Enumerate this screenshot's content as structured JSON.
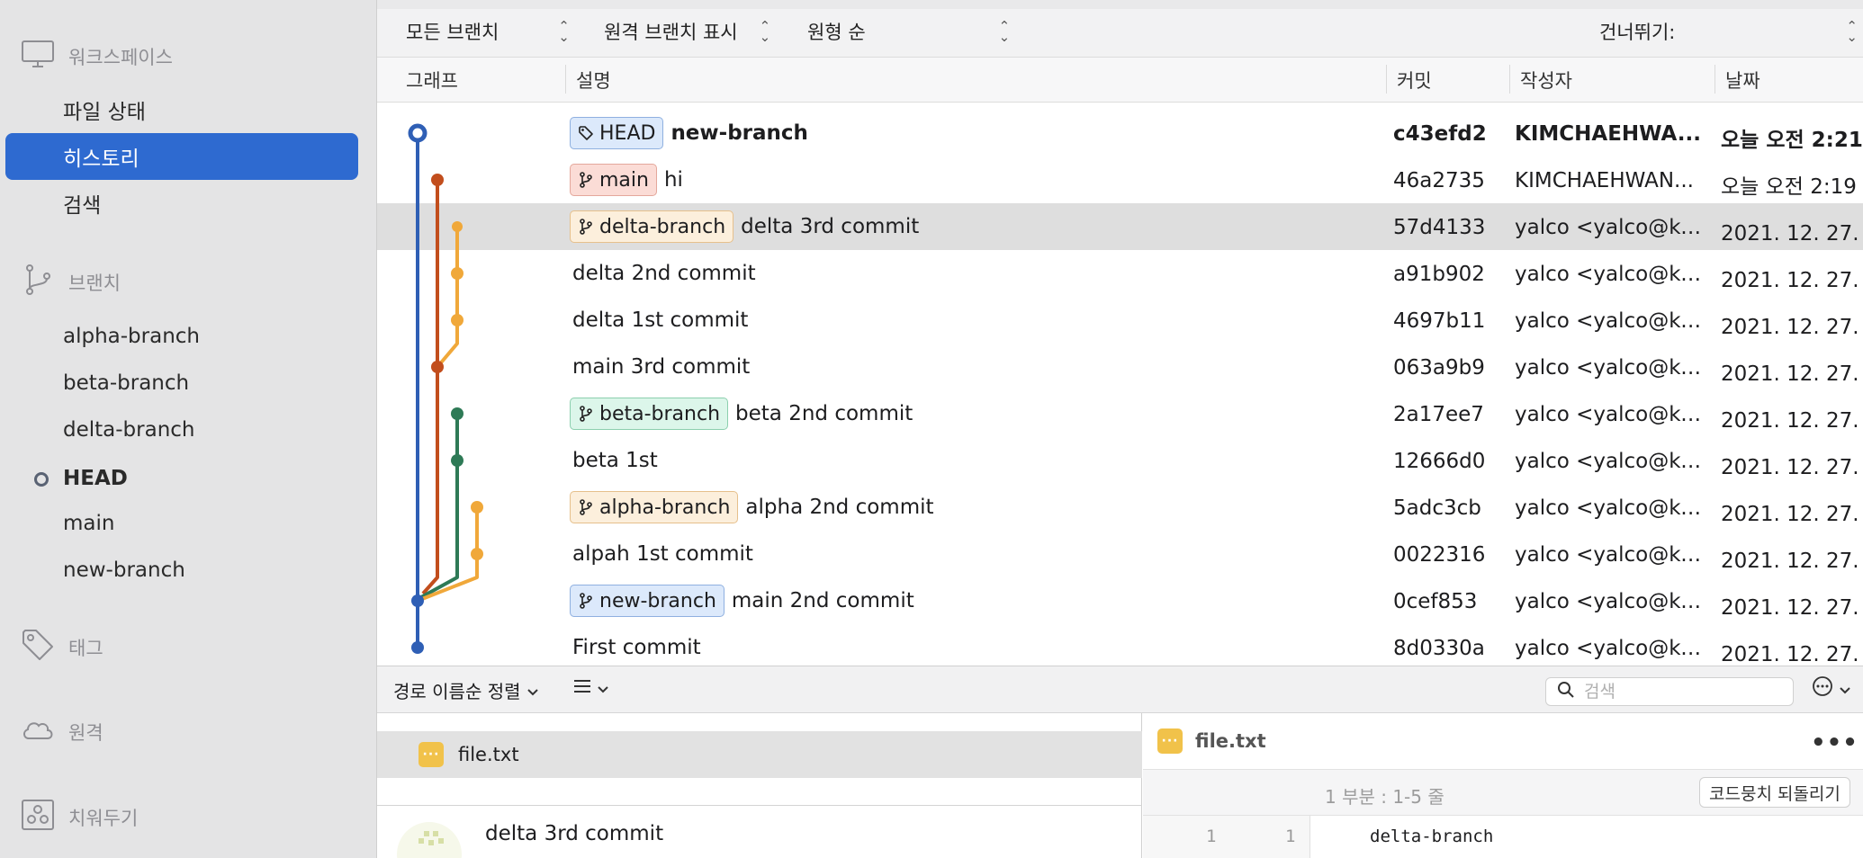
{
  "sidebar": {
    "workspace_label": "워크스페이스",
    "workspace_items": [
      {
        "label": "파일 상태",
        "active": false
      },
      {
        "label": "히스토리",
        "active": true
      },
      {
        "label": "검색",
        "active": false
      }
    ],
    "branches_label": "브랜치",
    "branches": [
      "alpha-branch",
      "beta-branch",
      "delta-branch",
      "HEAD",
      "main",
      "new-branch"
    ],
    "tags_label": "태그",
    "remotes_label": "원격",
    "stashes_label": "치워두기"
  },
  "filters": {
    "branch_filter": "모든 브랜치",
    "remote_filter": "원격 브랜치 표시",
    "order_filter": "원형 순",
    "jump_label": "건너뛰기:"
  },
  "columns": {
    "graph": "그래프",
    "description": "설명",
    "commit": "커밋",
    "author": "작성자",
    "date": "날짜"
  },
  "commits": [
    {
      "tag": "HEAD",
      "tag_kind": "head",
      "message": "new-branch",
      "hash": "c43efd2",
      "author": "KIMCHAEHWA...",
      "date": "오늘 오전 2:21",
      "bold": true,
      "selected": false
    },
    {
      "tag": "main",
      "tag_kind": "main",
      "message": "hi",
      "hash": "46a2735",
      "author": "KIMCHAEHWAN...",
      "date": "오늘 오전 2:19",
      "bold": false,
      "selected": false
    },
    {
      "tag": "delta-branch",
      "tag_kind": "delta",
      "message": "delta 3rd commit",
      "hash": "57d4133",
      "author": "yalco <yalco@ka...",
      "date": "2021. 12. 27. 오",
      "bold": false,
      "selected": true
    },
    {
      "tag": "",
      "tag_kind": "",
      "message": "delta 2nd commit",
      "hash": "a91b902",
      "author": "yalco <yalco@ka...",
      "date": "2021. 12. 27. 오",
      "bold": false,
      "selected": false
    },
    {
      "tag": "",
      "tag_kind": "",
      "message": "delta 1st commit",
      "hash": "4697b11",
      "author": "yalco <yalco@ka...",
      "date": "2021. 12. 27. 오",
      "bold": false,
      "selected": false
    },
    {
      "tag": "",
      "tag_kind": "",
      "message": "main 3rd commit",
      "hash": "063a9b9",
      "author": "yalco <yalco@ka...",
      "date": "2021. 12. 27. 오",
      "bold": false,
      "selected": false
    },
    {
      "tag": "beta-branch",
      "tag_kind": "beta",
      "message": "beta 2nd commit",
      "hash": "2a17ee7",
      "author": "yalco <yalco@ka...",
      "date": "2021. 12. 27. 오",
      "bold": false,
      "selected": false
    },
    {
      "tag": "",
      "tag_kind": "",
      "message": "beta 1st",
      "hash": "12666d0",
      "author": "yalco <yalco@ka...",
      "date": "2021. 12. 27. 오",
      "bold": false,
      "selected": false
    },
    {
      "tag": "alpha-branch",
      "tag_kind": "alpha",
      "message": "alpha 2nd commit",
      "hash": "5adc3cb",
      "author": "yalco <yalco@ka...",
      "date": "2021. 12. 27. 오",
      "bold": false,
      "selected": false
    },
    {
      "tag": "",
      "tag_kind": "",
      "message": "alpah 1st commit",
      "hash": "0022316",
      "author": "yalco <yalco@ka...",
      "date": "2021. 12. 27. 오",
      "bold": false,
      "selected": false
    },
    {
      "tag": "new-branch",
      "tag_kind": "newb",
      "message": "main 2nd commit",
      "hash": "0cef853",
      "author": "yalco <yalco@ka...",
      "date": "2021. 12. 27. 오",
      "bold": false,
      "selected": false
    },
    {
      "tag": "",
      "tag_kind": "",
      "message": "First commit",
      "hash": "8d0330a",
      "author": "yalco <yalco@ka...",
      "date": "2021. 12. 27. 오",
      "bold": false,
      "selected": false
    }
  ],
  "tag_colors": {
    "head": {
      "bg": "#dce9fb",
      "border": "#8fb0e0"
    },
    "main": {
      "bg": "#fbdcd6",
      "border": "#e4a89c"
    },
    "delta": {
      "bg": "#fcefdc",
      "border": "#e6c08c"
    },
    "beta": {
      "bg": "#dcf6ea",
      "border": "#8ccfae"
    },
    "alpha": {
      "bg": "#fcefdc",
      "border": "#e6c08c"
    },
    "newb": {
      "bg": "#dce9fb",
      "border": "#8fb0e0"
    }
  },
  "graph_colors": {
    "blue": "#2f5fb5",
    "red": "#c24e1d",
    "orange": "#f0a83a",
    "green": "#2e7a56"
  },
  "bottom_bar": {
    "sort_label": "경로 이름순 정렬",
    "search_placeholder": "검색"
  },
  "file_list": {
    "file_name": "file.txt",
    "commit_message": "delta 3rd commit"
  },
  "diff": {
    "file_name": "file.txt",
    "hunk_label": "1 부분 : 1-5 줄",
    "discard_button": "코드뭉치 되돌리기",
    "old_line": "1",
    "new_line": "1",
    "line_text": "delta-branch"
  },
  "accent_color": "#2e6ad0"
}
